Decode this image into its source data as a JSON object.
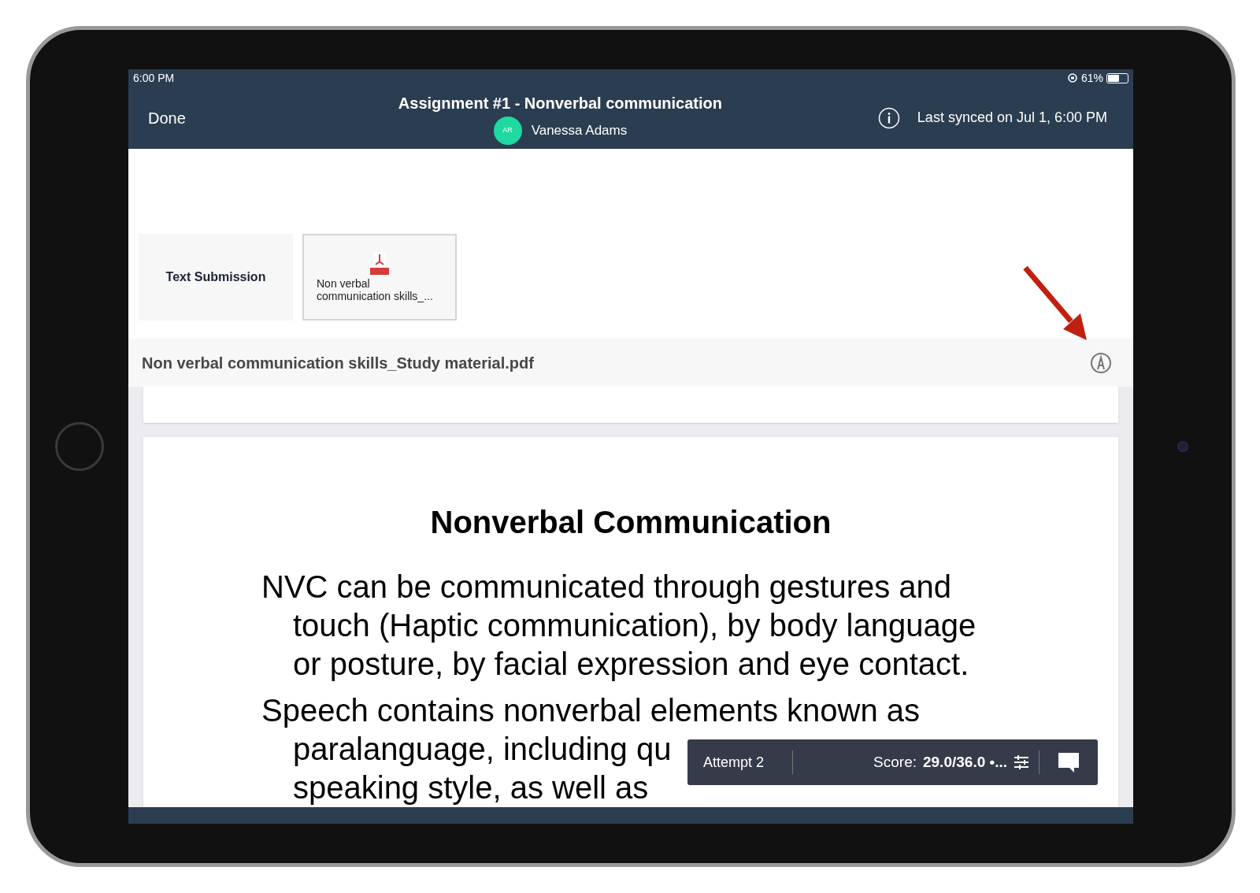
{
  "status_bar": {
    "time": "6:00 PM",
    "battery": "61%"
  },
  "header": {
    "done": "Done",
    "title": "Assignment #1 - Nonverbal communication",
    "student": {
      "initials": "AR",
      "name": "Vanessa Adams",
      "color": "#1ed9a0"
    },
    "sync": "Last synced on Jul 1, 6:00 PM"
  },
  "submissions": [
    {
      "kind": "text",
      "label": "Text Submission",
      "selected": false
    },
    {
      "kind": "file",
      "label": "Non verbal communication skills_...",
      "selected": true
    }
  ],
  "file_bar": {
    "filename": "Non verbal communication skills_Study material.pdf"
  },
  "document": {
    "heading": "Nonverbal Communication",
    "paragraphs": [
      {
        "lines": [
          "NVC can be communicated through gestures and",
          "touch (Haptic communication), by body language",
          "or posture, by facial expression and eye contact."
        ]
      },
      {
        "lines": [
          "Speech contains nonverbal elements known as",
          "paralanguage, including qu",
          "speaking style, as well as"
        ]
      }
    ]
  },
  "grading_bar": {
    "attempt": "Attempt 2",
    "score_label": "Score:",
    "score": "29.0/36.0 •..."
  }
}
